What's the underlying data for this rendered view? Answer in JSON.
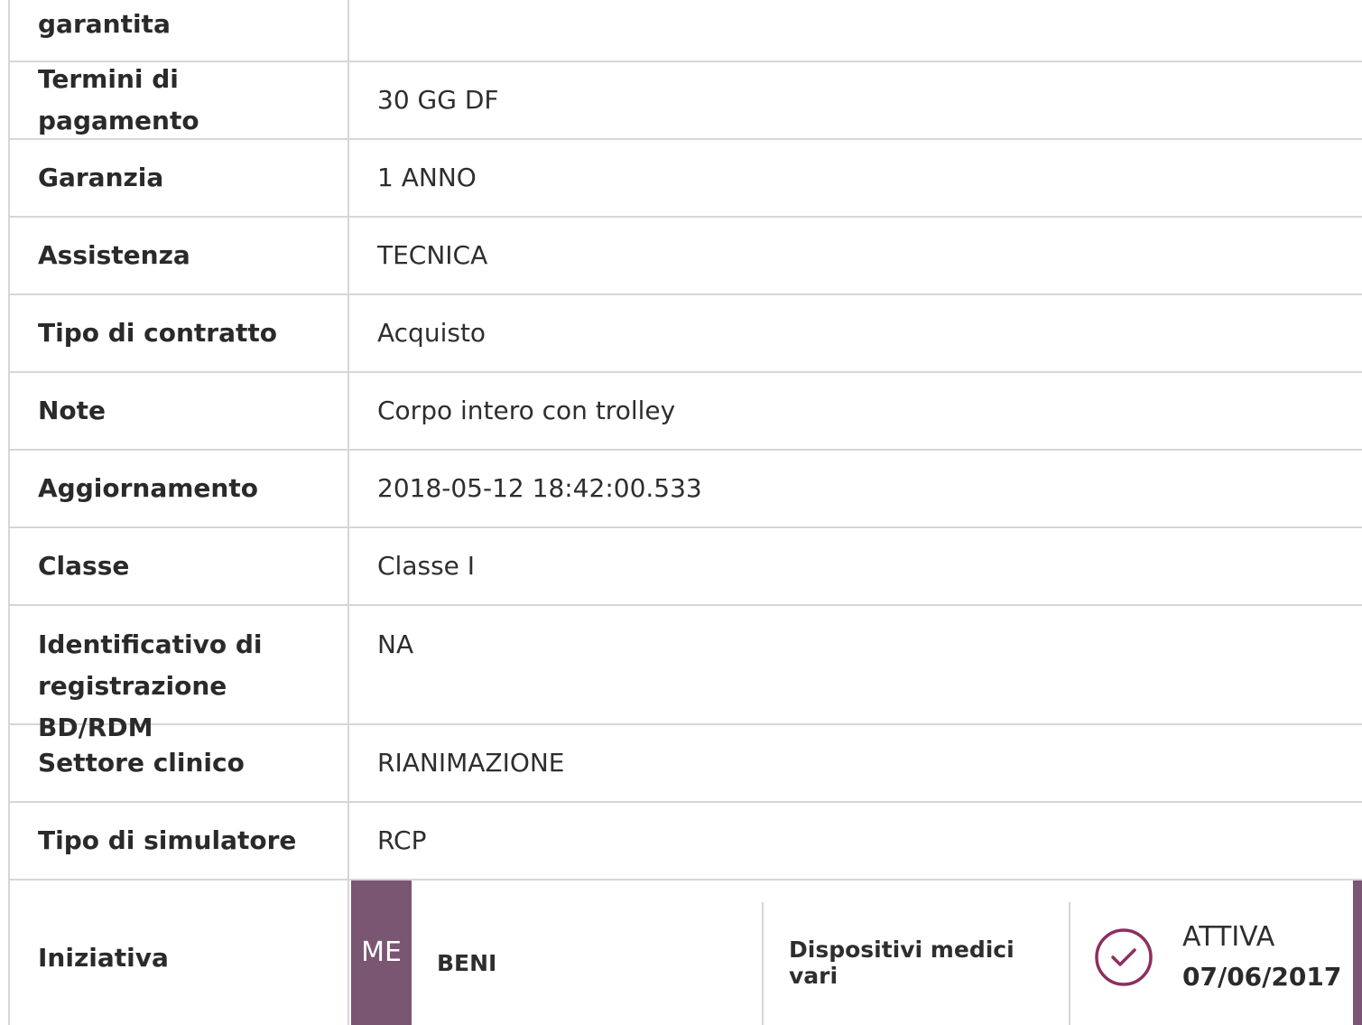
{
  "rows": [
    {
      "label": "garantita",
      "value": ""
    },
    {
      "label": "Termini di pagamento",
      "value": "30 GG DF"
    },
    {
      "label": "Garanzia",
      "value": "1 ANNO"
    },
    {
      "label": "Assistenza",
      "value": "TECNICA"
    },
    {
      "label": "Tipo di contratto",
      "value": "Acquisto"
    },
    {
      "label": "Note",
      "value": "Corpo intero con trolley"
    },
    {
      "label": "Aggiornamento",
      "value": "2018-05-12 18:42:00.533"
    },
    {
      "label": "Classe",
      "value": "Classe I"
    },
    {
      "label_line1": "Identificativo di",
      "label_line2": "registrazione BD/RDM",
      "value": "NA"
    },
    {
      "label": "Settore clinico",
      "value": "RIANIMAZIONE"
    },
    {
      "label": "Tipo di simulatore",
      "value": "RCP"
    }
  ],
  "iniziativa": {
    "label": "Iniziativa",
    "badge": "ME",
    "type": "BENI",
    "category": "Dispositivi medici vari",
    "status": "ATTIVA",
    "date": "07/06/2017",
    "status_icon": "check-circle-icon",
    "accent_color": "#7a5672"
  }
}
